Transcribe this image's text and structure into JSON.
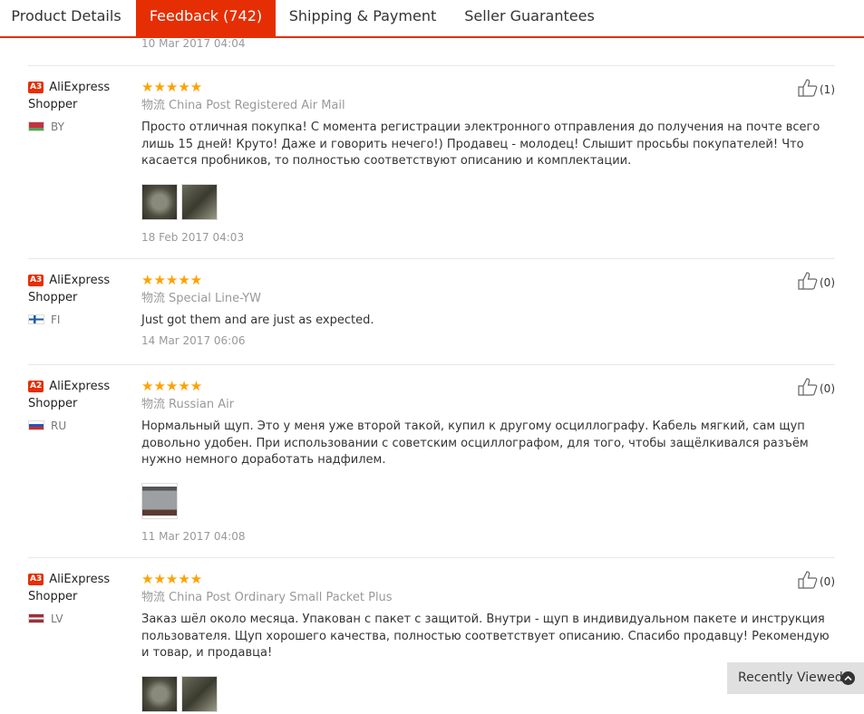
{
  "tabs": [
    {
      "label": "Product Details"
    },
    {
      "label": "Feedback (742)"
    },
    {
      "label": "Shipping & Payment"
    },
    {
      "label": "Seller Guarantees"
    }
  ],
  "previous_review_date": "10 Mar 2017 04:04",
  "shipping_prefix": "物流",
  "stars_glyphs": "★★★★★",
  "reviews": [
    {
      "badge": "A3",
      "user": "AliExpress Shopper",
      "country": "BY",
      "rating": 5,
      "shipping": "China Post Registered Air Mail",
      "text": "Просто отличная покупка! С момента регистрации электронного отправления до получения на почте всего лишь 15 дней! Круто! Даже и говорить нечего!) Продавец - молодец! Слышит просьбы покупателей! Что касается пробников, то полностью соответствуют описанию и комплектации.",
      "photos": 2,
      "date": "18 Feb 2017 04:03",
      "helpful": "(1)"
    },
    {
      "badge": "A3",
      "user": "AliExpress Shopper",
      "country": "FI",
      "rating": 5,
      "shipping": "Special Line-YW",
      "text": "Just got them and are just as expected.",
      "photos": 0,
      "date": "14 Mar 2017 06:06",
      "helpful": "(0)"
    },
    {
      "badge": "A2",
      "user": "AliExpress Shopper",
      "country": "RU",
      "rating": 5,
      "shipping": "Russian Air",
      "text": "Нормальный щуп. Это у меня уже второй такой, купил к другому осциллографу. Кабель мягкий, сам щуп довольно удобен. При использовании с советским осциллографом, для того, чтобы защёлкивался разъём нужно немного доработать надфилем.",
      "photos": 1,
      "date": "11 Mar 2017 04:08",
      "helpful": "(0)"
    },
    {
      "badge": "A3",
      "user": "AliExpress Shopper",
      "country": "LV",
      "rating": 5,
      "shipping": "China Post Ordinary Small Packet Plus",
      "text": "Заказ шёл около месяца. Упакован с пакет с защитой. Внутри - щуп в индивидуальном пакете и инструкция пользователя. Щуп хорошего качества, полностью соответствует описанию. Спасибо продавцу! Рекомендую и товар, и продавца!",
      "photos": 2,
      "date": "",
      "helpful": "(0)"
    }
  ],
  "recently_viewed": "Recently Viewed",
  "colors": {
    "accent": "#e62e04",
    "star": "#ffa200"
  }
}
